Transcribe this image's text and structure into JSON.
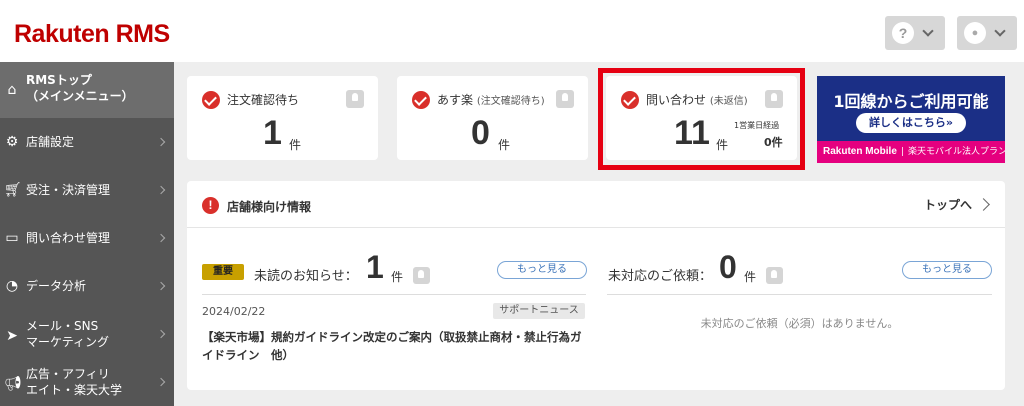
{
  "header": {
    "logo": "Rakuten RMS",
    "help_icon": "?",
    "user_icon": "●"
  },
  "sidebar": {
    "items": [
      {
        "icon": "home-icon",
        "label": "RMSトップ\n（メインメニュー）"
      },
      {
        "icon": "gear-icon",
        "label": "店舗設定"
      },
      {
        "icon": "cart-icon",
        "label": "受注・決済管理"
      },
      {
        "icon": "chat-icon",
        "label": "問い合わせ管理"
      },
      {
        "icon": "chart-icon",
        "label": "データ分析"
      },
      {
        "icon": "send-icon",
        "label": "メール・SNS\nマーケティング"
      },
      {
        "icon": "megaphone-icon",
        "label": "広告・アフィリ\nエイト・楽天大学"
      }
    ]
  },
  "cards": {
    "orders": {
      "title": "注文確認待ち",
      "count": "1",
      "unit": "件"
    },
    "asuraku": {
      "title": "あす楽",
      "title_sub": "(注文確認待ち)",
      "count": "0",
      "unit": "件"
    },
    "inquiry": {
      "title": "問い合わせ",
      "title_sub": "(未返信)",
      "count": "11",
      "unit": "件",
      "sub_label": "1営業日経過",
      "sub_count": "0件"
    }
  },
  "banner": {
    "title": "1回線からご利用可能",
    "button": "詳しくはこちら»",
    "brand": "Rakuten Mobile",
    "separator": "|",
    "plan": "楽天モバイル法人プラン"
  },
  "info_panel": {
    "icon": "!",
    "title": "店舗様向け情報",
    "top_link": "トップへ",
    "unread": {
      "badge": "重要",
      "label": "未読のお知らせ：",
      "count": "1",
      "unit": "件",
      "more": "もっと見る"
    },
    "news": {
      "date": "2024/02/22",
      "tag": "サポートニュース",
      "title": "【楽天市場】規約ガイドライン改定のご案内（取扱禁止商材・禁止行為ガイドライン　他）"
    },
    "pending": {
      "label": "未対応のご依頼：",
      "count": "0",
      "unit": "件",
      "more": "もっと見る",
      "empty": "未対応のご依頼（必須）はありません。"
    }
  },
  "colors": {
    "brand_red": "#bf0000",
    "highlight": "#e60012",
    "sidebar_bg": "#555555",
    "banner_blue": "#1b2f86",
    "banner_pink": "#e5007f"
  }
}
